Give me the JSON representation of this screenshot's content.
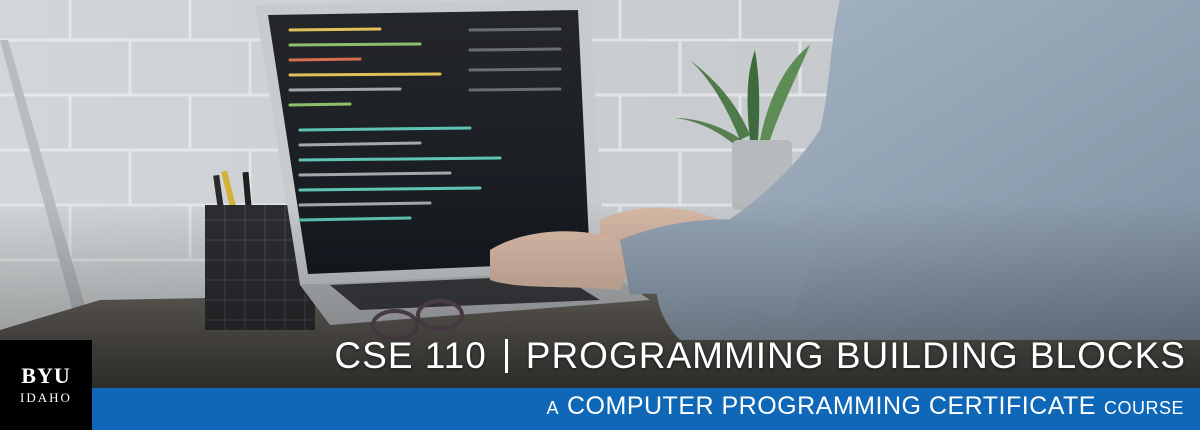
{
  "banner": {
    "title_code": "CSE 110",
    "title_name": "PROGRAMMING BUILDING BLOCKS",
    "subtitle_prefix": "A",
    "subtitle_main": "COMPUTER PROGRAMMING CERTIFICATE",
    "subtitle_suffix": "COURSE"
  },
  "logo": {
    "line1": "BYU",
    "line2": "IDAHO"
  },
  "colors": {
    "bar": "#0f67b8",
    "logo_bg": "#000000",
    "text": "#ffffff"
  }
}
